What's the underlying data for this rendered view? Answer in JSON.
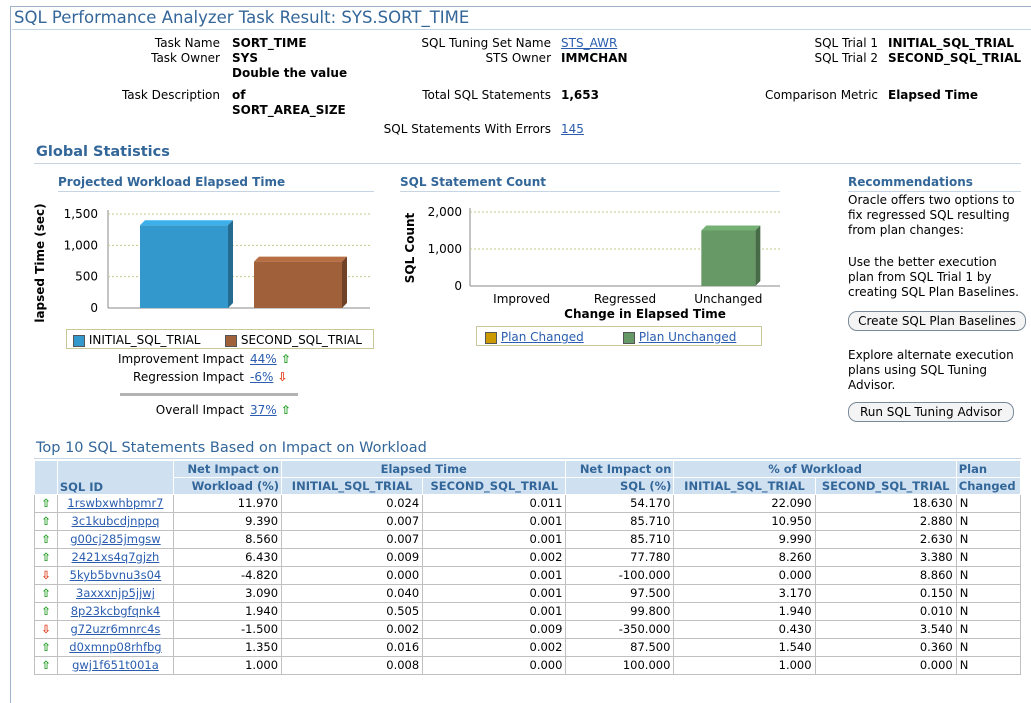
{
  "page_title": "SQL Performance Analyzer Task Result: SYS.SORT_TIME",
  "summary": {
    "task_name_label": "Task Name",
    "task_name": "SORT_TIME",
    "task_owner_label": "Task Owner",
    "task_owner": "SYS",
    "task_desc_label": "Task Description",
    "task_desc_1": "Double the value",
    "task_desc_2": "of",
    "task_desc_3": "SORT_AREA_SIZE",
    "sts_name_label": "SQL Tuning Set Name",
    "sts_name": "STS_AWR",
    "sts_owner_label": "STS Owner",
    "sts_owner": "IMMCHAN",
    "total_label": "Total SQL Statements",
    "total": "1,653",
    "errors_label": "SQL Statements With Errors",
    "errors": "145",
    "trial1_label": "SQL Trial 1",
    "trial1": "INITIAL_SQL_TRIAL",
    "trial2_label": "SQL Trial 2",
    "trial2": "SECOND_SQL_TRIAL",
    "metric_label": "Comparison Metric",
    "metric": "Elapsed Time"
  },
  "global_stats": {
    "heading": "Global Statistics",
    "workload_heading": "Projected Workload Elapsed Time",
    "count_heading": "SQL Statement Count",
    "rec_heading": "Recommendations"
  },
  "chart_data": [
    {
      "type": "bar",
      "ylabel": "lapsed Time (sec)",
      "ylim": [
        0,
        1500
      ],
      "yticks": [
        "0",
        "500",
        "1,000",
        "1,500"
      ],
      "series": [
        {
          "name": "INITIAL_SQL_TRIAL",
          "values": [
            1320
          ],
          "color": "#3399cc"
        },
        {
          "name": "SECOND_SQL_TRIAL",
          "values": [
            740
          ],
          "color": "#a0603a"
        }
      ],
      "grid": true,
      "legend": "bottom"
    },
    {
      "type": "bar",
      "xlabel": "Change in Elapsed Time",
      "ylabel": "SQL Count",
      "ylim": [
        0,
        2000
      ],
      "yticks": [
        "0",
        "1,000",
        "2,000"
      ],
      "categories": [
        "Improved",
        "Regressed",
        "Unchanged"
      ],
      "values": [
        0,
        0,
        1500
      ],
      "color": "#669966",
      "legend_items": [
        {
          "name": "Plan Changed",
          "color": "#cc9900"
        },
        {
          "name": "Plan Unchanged",
          "color": "#669966"
        }
      ],
      "grid": true,
      "legend": "bottom"
    }
  ],
  "impacts": {
    "improvement_label": "Improvement Impact",
    "improvement": "44%",
    "regression_label": "Regression Impact",
    "regression": "-6%",
    "overall_label": "Overall Impact",
    "overall": "37%"
  },
  "recommendations": {
    "text1": [
      "Oracle offers two options to",
      "fix regressed SQL resulting",
      "from plan changes:"
    ],
    "text2": [
      "Use the better execution",
      "plan from SQL Trial 1 by",
      "creating SQL Plan Baselines."
    ],
    "btn1": "Create SQL Plan Baselines",
    "text3": [
      "Explore alternate execution",
      "plans using SQL Tuning",
      "Advisor."
    ],
    "btn2": "Run SQL Tuning Advisor"
  },
  "top10": {
    "heading": "Top 10 SQL Statements Based on Impact on Workload",
    "headers": {
      "sql_id": "SQL ID",
      "net_wl_1": "Net Impact on",
      "net_wl_2": "Workload (%)",
      "elapsed": "Elapsed Time",
      "trial1": "INITIAL_SQL_TRIAL",
      "trial2": "SECOND_SQL_TRIAL",
      "net_sql_1": "Net Impact on",
      "net_sql_2": "SQL (%)",
      "pct_wl": "% of Workload",
      "plan_1": "Plan",
      "plan_2": "Changed"
    },
    "rows": [
      {
        "dir": "up",
        "id": "1rswbxwhbpmr7",
        "nwl": "11.970",
        "e1": "0.024",
        "e2": "0.011",
        "nsql": "54.170",
        "w1": "22.090",
        "w2": "18.630",
        "pc": "N"
      },
      {
        "dir": "up",
        "id": "3c1kubcdjnppq",
        "nwl": "9.390",
        "e1": "0.007",
        "e2": "0.001",
        "nsql": "85.710",
        "w1": "10.950",
        "w2": "2.880",
        "pc": "N"
      },
      {
        "dir": "up",
        "id": "g00cj285jmgsw",
        "nwl": "8.560",
        "e1": "0.007",
        "e2": "0.001",
        "nsql": "85.710",
        "w1": "9.990",
        "w2": "2.630",
        "pc": "N"
      },
      {
        "dir": "up",
        "id": "2421xs4q7gjzh",
        "nwl": "6.430",
        "e1": "0.009",
        "e2": "0.002",
        "nsql": "77.780",
        "w1": "8.260",
        "w2": "3.380",
        "pc": "N"
      },
      {
        "dir": "down",
        "id": "5kyb5bvnu3s04",
        "nwl": "-4.820",
        "e1": "0.000",
        "e2": "0.001",
        "nsql": "-100.000",
        "w1": "0.000",
        "w2": "8.860",
        "pc": "N"
      },
      {
        "dir": "up",
        "id": "3axxxnjp5jjwj",
        "nwl": "3.090",
        "e1": "0.040",
        "e2": "0.001",
        "nsql": "97.500",
        "w1": "3.170",
        "w2": "0.150",
        "pc": "N"
      },
      {
        "dir": "up",
        "id": "8p23kcbgfqnk4",
        "nwl": "1.940",
        "e1": "0.505",
        "e2": "0.001",
        "nsql": "99.800",
        "w1": "1.940",
        "w2": "0.010",
        "pc": "N"
      },
      {
        "dir": "down",
        "id": "g72uzr6mnrc4s",
        "nwl": "-1.500",
        "e1": "0.002",
        "e2": "0.009",
        "nsql": "-350.000",
        "w1": "0.430",
        "w2": "3.540",
        "pc": "N"
      },
      {
        "dir": "up",
        "id": "d0xmnp08rhfbg",
        "nwl": "1.350",
        "e1": "0.016",
        "e2": "0.002",
        "nsql": "87.500",
        "w1": "1.540",
        "w2": "0.360",
        "pc": "N"
      },
      {
        "dir": "up",
        "id": "gwj1f651t001a",
        "nwl": "1.000",
        "e1": "0.008",
        "e2": "0.000",
        "nsql": "100.000",
        "w1": "1.000",
        "w2": "0.000",
        "pc": "N"
      }
    ]
  }
}
